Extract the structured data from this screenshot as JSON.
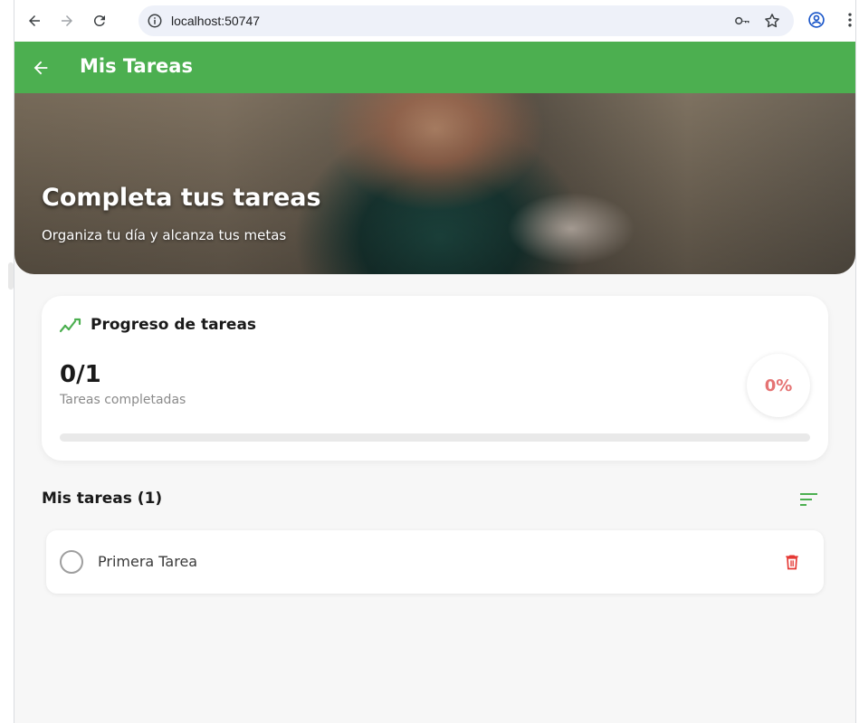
{
  "browser": {
    "url": "localhost:50747",
    "icons": [
      "back-arrow-icon",
      "forward-arrow-icon",
      "reload-icon",
      "info-icon",
      "key-icon",
      "star-icon",
      "profile-icon",
      "more-vert-icon"
    ]
  },
  "appbar": {
    "title": "Mis Tareas",
    "color": "#4caf50"
  },
  "hero": {
    "title": "Completa tus tareas",
    "subtitle": "Organiza tu día y alcanza tus metas"
  },
  "progress": {
    "title": "Progreso de tareas",
    "count": "0/1",
    "subtitle": "Tareas completadas",
    "percent_label": "0%",
    "fraction": 0,
    "accent": "#4caf50",
    "percent_color": "#e57373"
  },
  "tasks": {
    "title": "Mis tareas (1)",
    "items": [
      {
        "label": "Primera Tarea",
        "done": false
      }
    ]
  }
}
